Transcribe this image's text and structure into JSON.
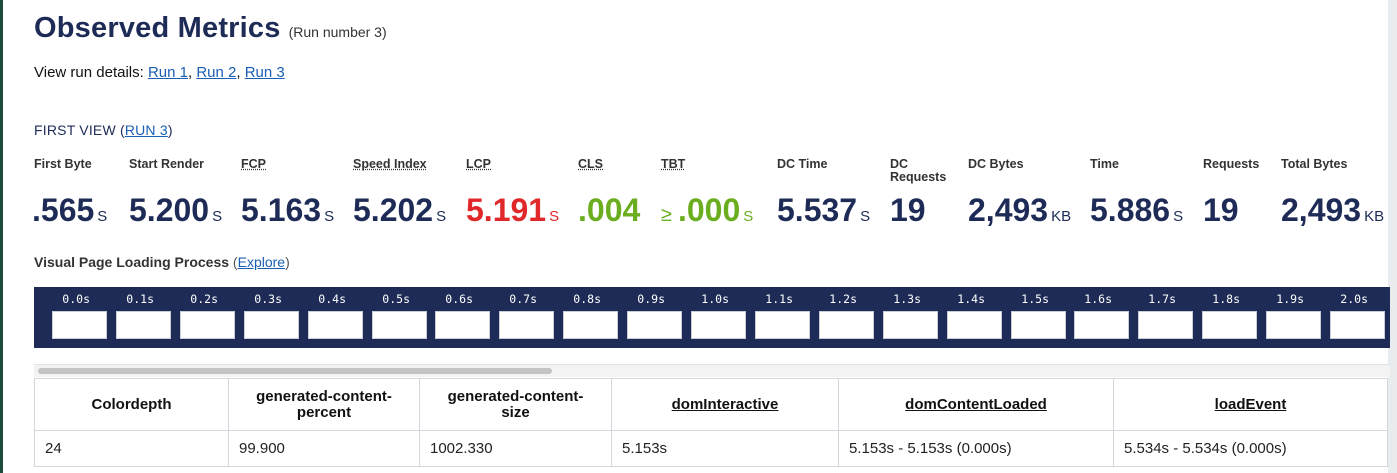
{
  "header": {
    "title": "Observed Metrics",
    "run_note": "(Run number 3)",
    "details_prefix": "View run details: ",
    "runs": [
      "Run 1",
      "Run 2",
      "Run 3"
    ],
    "sep": ", "
  },
  "first_view": {
    "prefix": "FIRST VIEW (",
    "run_link": "RUN 3",
    "suffix": ")"
  },
  "metrics": [
    {
      "label": "First Byte",
      "value": ".565",
      "unit": "S"
    },
    {
      "label": "Start Render",
      "value": "5.200",
      "unit": "S"
    },
    {
      "label": "FCP",
      "value": "5.163",
      "unit": "S"
    },
    {
      "label": "Speed Index",
      "value": "5.202",
      "unit": "S"
    },
    {
      "label": "LCP",
      "value": "5.191",
      "unit": "S"
    },
    {
      "label": "CLS",
      "value": ".004"
    },
    {
      "label": "TBT",
      "prefix": "≥",
      "value": ".000",
      "unit": "S"
    },
    {
      "label": "DC Time",
      "value": "5.537",
      "unit": "S"
    },
    {
      "label": "DC Requests",
      "value": "19"
    },
    {
      "label": "DC Bytes",
      "value": "2,493",
      "unit": "KB"
    },
    {
      "label": "Time",
      "value": "5.886",
      "unit": "S"
    },
    {
      "label": "Requests",
      "value": "19"
    },
    {
      "label": "Total Bytes",
      "value": "2,493",
      "unit": "KB"
    }
  ],
  "metric_colors": {
    "default": "#1d2b56",
    "poor": "#e0282a",
    "good": "#6aad1f"
  },
  "visual": {
    "title": "Visual Page Loading Process",
    "open": " (",
    "explore": "Explore",
    "close": ")"
  },
  "filmstrip": {
    "times": [
      "0.0s",
      "0.1s",
      "0.2s",
      "0.3s",
      "0.4s",
      "0.5s",
      "0.6s",
      "0.7s",
      "0.8s",
      "0.9s",
      "1.0s",
      "1.1s",
      "1.2s",
      "1.3s",
      "1.4s",
      "1.5s",
      "1.6s",
      "1.7s",
      "1.8s",
      "1.9s",
      "2.0s"
    ]
  },
  "table": {
    "headers": [
      "Colordepth",
      "generated-content-percent",
      "generated-content-size",
      "domInteractive",
      "domContentLoaded",
      "loadEvent"
    ],
    "header_lines": [
      [
        "Colordepth"
      ],
      [
        "generated-content-",
        "percent"
      ],
      [
        "generated-content-",
        "size"
      ],
      [
        "domInteractive"
      ],
      [
        "domContentLoaded"
      ],
      [
        "loadEvent"
      ]
    ],
    "row": [
      "24",
      "99.900",
      "1002.330",
      "5.153s",
      "5.153s - 5.153s (0.000s)",
      "5.534s - 5.534s (0.000s)"
    ]
  }
}
